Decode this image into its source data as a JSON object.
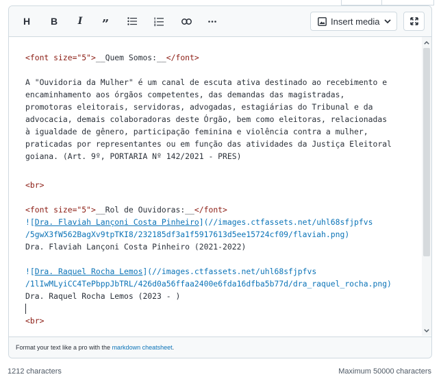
{
  "toolbar": {
    "heading": "H",
    "bold": "B",
    "italic": "I",
    "quote": "”",
    "insert_media": "Insert media"
  },
  "code": {
    "line1": {
      "tag_open": "<font size=\"5\">",
      "text": "__Quem Somos:__",
      "tag_close": "</font>"
    },
    "para": [
      "A \"Ouvidoria da Mulher\" é um canal de escuta ativa destinado ao recebimento e",
      "encaminhamento aos órgãos competentes, das demandas das magistradas,",
      "promotoras eleitorais, servidoras, advogadas, estagiárias do Tribunal e da",
      "advocacia, demais colaboradoras deste Órgão, bem como eleitoras, relacionadas",
      "à igualdade de gênero, participação feminina e violência contra a mulher,",
      "praticadas por representantes ou em função das atividades da Justiça Eleitoral",
      "goiana. (Art. 9º, PORTARIA Nº 142/2021 - PRES)"
    ],
    "br": "<br>",
    "line2": {
      "tag_open": "<font size=\"5\">",
      "text": "__Rol de Ouvidoras:__",
      "tag_close": "</font>"
    },
    "img1": {
      "bang": "![",
      "alt": "Dra. Flaviah Lançoni Costa Pinheiro",
      "mid": "](",
      "url_a": "//images.ctfassets.net/uhl68sfjpfvs",
      "url_b": "/5gwX3fW562BagXv9tpTKI8/232185df3a1f5917613d5ee15724cf09/flaviah.png",
      "close": ")",
      "caption": "Dra. Flaviah Lançoni Costa Pinheiro (2021-2022)"
    },
    "img2": {
      "bang": "![",
      "alt": "Dra. Raquel Rocha Lemos",
      "mid": "](",
      "url_a": "//images.ctfassets.net/uhl68sfjpfvs",
      "url_b": "/1lIwMLyiCC4TePbppJbTRL/426d0a56ffaa2400e6fda16dfba5b77d/dra_raquel_rocha.png",
      "close": ")",
      "caption": "Dra. Raquel Rocha Lemos (2023 - )"
    },
    "br2": "<br>"
  },
  "footer": {
    "hint_prefix": "Format your text like a pro with the ",
    "hint_link": "markdown cheatsheet",
    "hint_suffix": "."
  },
  "status": {
    "char_count": "1212 characters",
    "max_chars": "Maximum 50000 characters"
  },
  "colors": {
    "tag": "#8b1c13",
    "link": "#0b73b7",
    "border": "#cfd9e0",
    "toolbar_bg": "#f7f9fa"
  }
}
